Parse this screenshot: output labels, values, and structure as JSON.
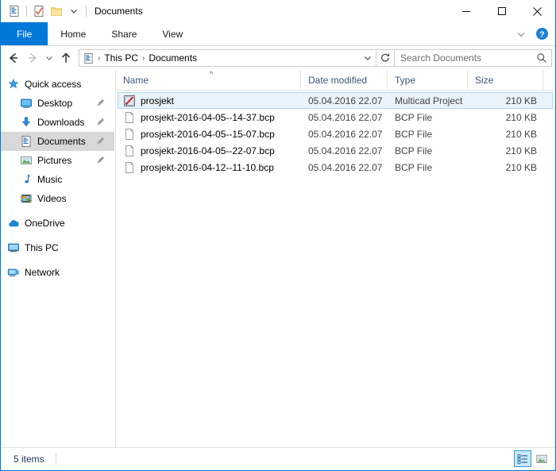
{
  "window": {
    "title": "Documents",
    "accent_color": "#0078d7",
    "quick_access_toolbar": [
      {
        "name": "properties-icon",
        "label": "Properties"
      },
      {
        "name": "new-folder-check-icon",
        "label": "New folder"
      },
      {
        "name": "folder-icon",
        "label": "Folder"
      },
      {
        "name": "chevron-down-icon",
        "label": "Customize Quick Access Toolbar"
      }
    ],
    "controls": {
      "minimize": "Minimize",
      "maximize": "Maximize",
      "close": "Close"
    }
  },
  "ribbon": {
    "tabs": [
      {
        "label": "File",
        "active": true
      },
      {
        "label": "Home",
        "active": false
      },
      {
        "label": "Share",
        "active": false
      },
      {
        "label": "View",
        "active": false
      }
    ],
    "collapse_label": "Minimize the Ribbon",
    "help_label": "Help"
  },
  "navigation": {
    "back_label": "Back",
    "forward_label": "Forward",
    "recent_label": "Recent locations",
    "up_label": "Up",
    "breadcrumb": [
      "This PC",
      "Documents"
    ],
    "breadcrumb_separator": "›",
    "dropdown_label": "Previous locations",
    "refresh_label": "Refresh"
  },
  "search": {
    "placeholder": "Search Documents",
    "value": ""
  },
  "sidebar": {
    "groups": [
      {
        "items": [
          {
            "label": "Quick access",
            "icon": "star-icon",
            "selected": false,
            "indent": false,
            "pinned": false
          },
          {
            "label": "Desktop",
            "icon": "desktop-icon",
            "selected": false,
            "indent": true,
            "pinned": true
          },
          {
            "label": "Downloads",
            "icon": "downloads-icon",
            "selected": false,
            "indent": true,
            "pinned": true
          },
          {
            "label": "Documents",
            "icon": "documents-icon",
            "selected": true,
            "indent": true,
            "pinned": true
          },
          {
            "label": "Pictures",
            "icon": "pictures-icon",
            "selected": false,
            "indent": true,
            "pinned": true
          },
          {
            "label": "Music",
            "icon": "music-icon",
            "selected": false,
            "indent": true,
            "pinned": false
          },
          {
            "label": "Videos",
            "icon": "videos-icon",
            "selected": false,
            "indent": true,
            "pinned": false
          }
        ]
      },
      {
        "items": [
          {
            "label": "OneDrive",
            "icon": "onedrive-icon",
            "selected": false,
            "indent": false,
            "pinned": false
          }
        ]
      },
      {
        "items": [
          {
            "label": "This PC",
            "icon": "this-pc-icon",
            "selected": false,
            "indent": false,
            "pinned": false
          }
        ]
      },
      {
        "items": [
          {
            "label": "Network",
            "icon": "network-icon",
            "selected": false,
            "indent": false,
            "pinned": false
          }
        ]
      }
    ]
  },
  "file_list": {
    "columns": [
      {
        "key": "name",
        "label": "Name",
        "sorted": true,
        "sort_direction": "asc"
      },
      {
        "key": "date",
        "label": "Date modified",
        "sorted": false
      },
      {
        "key": "type",
        "label": "Type",
        "sorted": false
      },
      {
        "key": "size",
        "label": "Size",
        "sorted": false
      }
    ],
    "rows": [
      {
        "name": "prosjekt",
        "date": "05.04.2016 22.07",
        "type": "Multicad Project",
        "size": "210 KB",
        "icon": "multicad-project-icon",
        "selected": true
      },
      {
        "name": "prosjekt-2016-04-05--14-37.bcp",
        "date": "05.04.2016 22.07",
        "type": "BCP File",
        "size": "210 KB",
        "icon": "generic-file-icon",
        "selected": false
      },
      {
        "name": "prosjekt-2016-04-05--15-07.bcp",
        "date": "05.04.2016 22.07",
        "type": "BCP File",
        "size": "210 KB",
        "icon": "generic-file-icon",
        "selected": false
      },
      {
        "name": "prosjekt-2016-04-05--22-07.bcp",
        "date": "05.04.2016 22.07",
        "type": "BCP File",
        "size": "210 KB",
        "icon": "generic-file-icon",
        "selected": false
      },
      {
        "name": "prosjekt-2016-04-12--11-10.bcp",
        "date": "05.04.2016 22.07",
        "type": "BCP File",
        "size": "210 KB",
        "icon": "generic-file-icon",
        "selected": false
      }
    ]
  },
  "status_bar": {
    "item_count": "5 items",
    "views": [
      {
        "name": "details-view-button",
        "label": "Details view",
        "active": true
      },
      {
        "name": "large-icons-view-button",
        "label": "Large icons view",
        "active": false
      }
    ]
  }
}
